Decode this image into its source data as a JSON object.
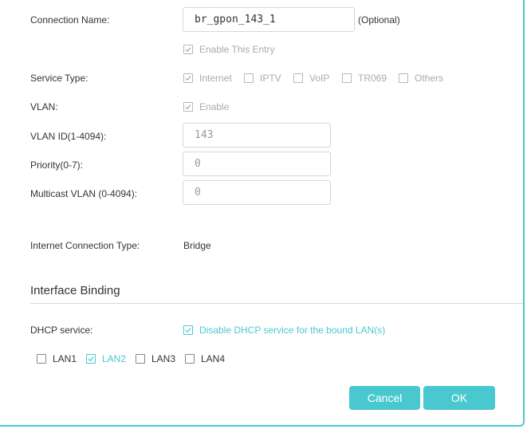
{
  "colors": {
    "accent": "#4ac8cf",
    "text": "#333333",
    "disabled": "#aaaaaa"
  },
  "connection": {
    "label": "Connection Name:",
    "value": "br_gpon_143_1",
    "optional": "(Optional)",
    "enable_entry": {
      "label": "Enable This Entry",
      "checked": true,
      "disabled": true
    }
  },
  "service_type": {
    "label": "Service Type:",
    "options": [
      {
        "label": "Internet",
        "checked": true
      },
      {
        "label": "IPTV",
        "checked": false
      },
      {
        "label": "VoIP",
        "checked": false
      },
      {
        "label": "TR069",
        "checked": false
      },
      {
        "label": "Others",
        "checked": false
      }
    ]
  },
  "vlan": {
    "label": "VLAN:",
    "enable": {
      "label": "Enable",
      "checked": true,
      "disabled": true
    }
  },
  "vlan_id": {
    "label": "VLAN ID(1-4094):",
    "value": "143"
  },
  "priority": {
    "label": "Priority(0-7):",
    "value": "0"
  },
  "multicast_vlan": {
    "label": "Multicast VLAN (0-4094):",
    "value": "0"
  },
  "internet_connection_type": {
    "label": "Internet Connection Type:",
    "value": "Bridge"
  },
  "interface_binding": {
    "title": "Interface Binding",
    "dhcp": {
      "label": "DHCP service:",
      "option": {
        "label": "Disable DHCP service for the bound LAN(s)",
        "checked": true
      }
    },
    "lans": [
      {
        "label": "LAN1",
        "checked": false
      },
      {
        "label": "LAN2",
        "checked": true
      },
      {
        "label": "LAN3",
        "checked": false
      },
      {
        "label": "LAN4",
        "checked": false
      }
    ]
  },
  "buttons": {
    "cancel": "Cancel",
    "ok": "OK"
  }
}
